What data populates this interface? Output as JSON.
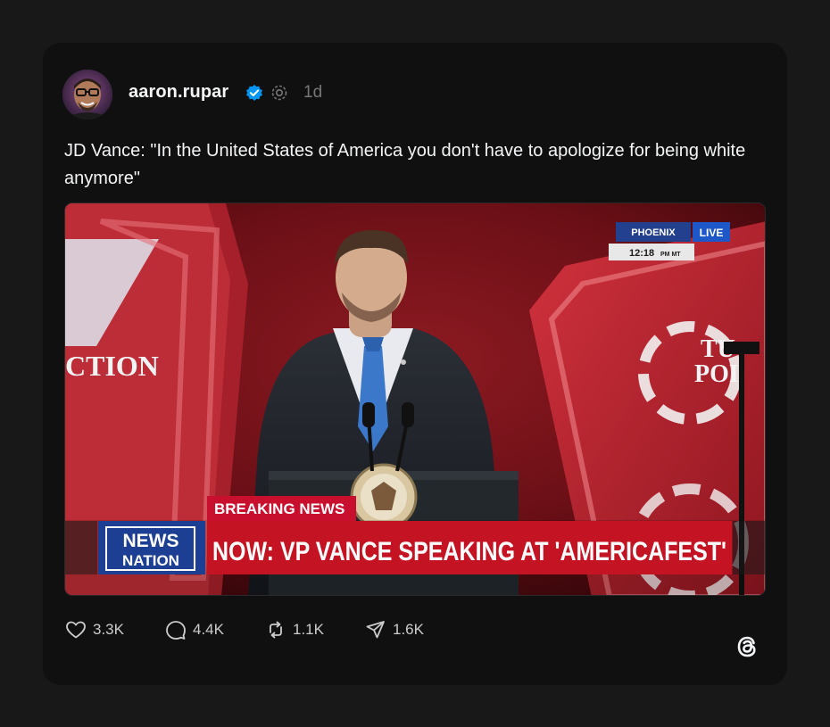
{
  "post": {
    "username": "aaron.rupar",
    "time": "1d",
    "text": "JD Vance: \"In the United States of America you don't have to apologize for being white anymore\""
  },
  "media": {
    "location": "PHOENIX",
    "live": "LIVE",
    "clock": "12:18",
    "clock_suffix": "PM MT",
    "breaking": "BREAKING NEWS",
    "headline": "NOW: VP VANCE SPEAKING AT 'AMERICAFEST'",
    "network_top": "NEWS",
    "network_bottom": "NATION",
    "backdrop_text": "CTION",
    "backdrop_right_top": "TU",
    "backdrop_right_bottom": "POI"
  },
  "actions": {
    "likes": "3.3K",
    "replies": "4.4K",
    "reposts": "1.1K",
    "shares": "1.6K"
  },
  "colors": {
    "background": "#181818",
    "card": "#101010",
    "verified": "#0095f6",
    "breaking_red": "#c8102e",
    "news_nation_blue": "#1c3f94"
  }
}
